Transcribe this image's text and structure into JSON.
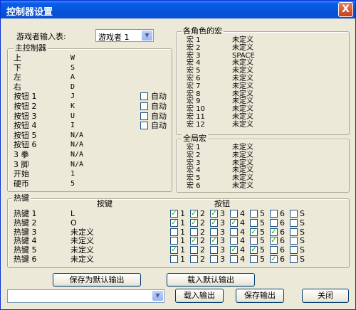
{
  "window": {
    "title": "控制器设置",
    "close_label": "X"
  },
  "player": {
    "label": "游戏者输入表:",
    "value": "游戏者 1"
  },
  "main_controller": {
    "title": "主控制器",
    "rows": [
      {
        "label": "上",
        "key": "W",
        "auto": null
      },
      {
        "label": "下",
        "key": "S",
        "auto": null
      },
      {
        "label": "左",
        "key": "A",
        "auto": null
      },
      {
        "label": "右",
        "key": "D",
        "auto": null
      },
      {
        "label": "按钮 1",
        "key": "J",
        "auto": "自动"
      },
      {
        "label": "按钮 2",
        "key": "K",
        "auto": "自动"
      },
      {
        "label": "按钮 3",
        "key": "U",
        "auto": "自动"
      },
      {
        "label": "按钮 4",
        "key": "I",
        "auto": "自动"
      },
      {
        "label": "按钮 5",
        "key": "N/A",
        "auto": null
      },
      {
        "label": "按钮 6",
        "key": "N/A",
        "auto": null
      },
      {
        "label": "3 拳",
        "key": "N/A",
        "auto": null
      },
      {
        "label": "3 脚",
        "key": "N/A",
        "auto": null
      },
      {
        "label": "开始",
        "key": "1",
        "auto": null
      },
      {
        "label": "硬币",
        "key": "5",
        "auto": null
      }
    ]
  },
  "char_macros": {
    "title": "各角色的宏",
    "rows": [
      {
        "label": "宏 1",
        "value": "未定义"
      },
      {
        "label": "宏 2",
        "value": "未定义"
      },
      {
        "label": "宏 3",
        "value": "SPACE"
      },
      {
        "label": "宏 4",
        "value": "未定义"
      },
      {
        "label": "宏 5",
        "value": "未定义"
      },
      {
        "label": "宏 6",
        "value": "未定义"
      },
      {
        "label": "宏 7",
        "value": "未定义"
      },
      {
        "label": "宏 8",
        "value": "未定义"
      },
      {
        "label": "宏 9",
        "value": "未定义"
      },
      {
        "label": "宏 10",
        "value": "未定义"
      },
      {
        "label": "宏 11",
        "value": "未定义"
      },
      {
        "label": "宏 12",
        "value": "未定义"
      }
    ]
  },
  "global_macros": {
    "title": "全局宏",
    "rows": [
      {
        "label": "宏 1",
        "value": "未定义"
      },
      {
        "label": "宏 2",
        "value": "未定义"
      },
      {
        "label": "宏 3",
        "value": "未定义"
      },
      {
        "label": "宏 4",
        "value": "未定义"
      },
      {
        "label": "宏 5",
        "value": "未定义"
      },
      {
        "label": "宏 6",
        "value": "未定义"
      }
    ]
  },
  "hotkeys": {
    "title": "热键",
    "key_header": "按键",
    "buttons_header": "按钮",
    "button_labels": [
      "1",
      "2",
      "3",
      "4",
      "5",
      "6",
      "S"
    ],
    "rows": [
      {
        "label": "热键 1",
        "key": "L",
        "checks": [
          true,
          true,
          true,
          false,
          false,
          false,
          false
        ]
      },
      {
        "label": "热键 2",
        "key": "O",
        "checks": [
          true,
          true,
          true,
          true,
          false,
          false,
          false
        ]
      },
      {
        "label": "热键 3",
        "key": "未定义",
        "checks": [
          false,
          false,
          false,
          false,
          true,
          true,
          false
        ]
      },
      {
        "label": "热键 4",
        "key": "未定义",
        "checks": [
          false,
          true,
          true,
          false,
          false,
          true,
          false
        ]
      },
      {
        "label": "热键 5",
        "key": "未定义",
        "checks": [
          true,
          false,
          false,
          true,
          true,
          false,
          false
        ]
      },
      {
        "label": "热键 6",
        "key": "未定义",
        "checks": [
          false,
          false,
          false,
          false,
          false,
          true,
          false
        ]
      }
    ]
  },
  "actions": {
    "save_default": "保存为默认输出",
    "load_default": "载入默认输出",
    "output_select": "",
    "load_output": "载入输出",
    "save_output": "保存输出",
    "close": "关闭"
  }
}
